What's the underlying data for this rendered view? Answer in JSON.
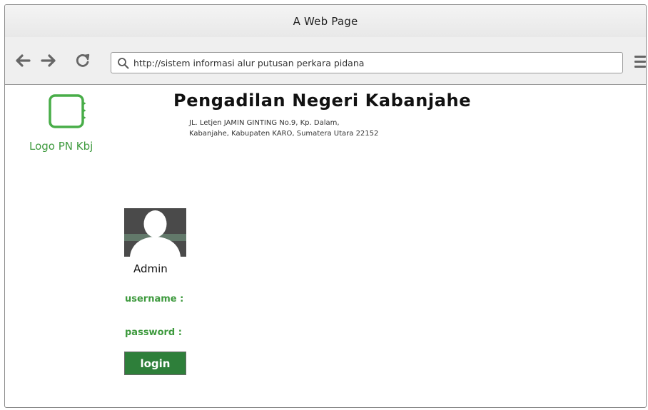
{
  "window": {
    "title": "A Web Page"
  },
  "toolbar": {
    "url": "http://sistem informasi alur putusan perkara pidana",
    "icons": [
      "back-arrow-icon",
      "forward-arrow-icon",
      "reload-icon",
      "search-icon",
      "hamburger-menu-icon"
    ]
  },
  "header": {
    "logo_label": "Logo PN Kbj",
    "title": "Pengadilan Negeri Kabanjahe",
    "address_line1": "JL. Letjen JAMIN GINTING No.9, Kp. Dalam,",
    "address_line2": "Kabanjahe, Kabupaten KARO, Sumatera Utara 22152"
  },
  "login": {
    "role_label": "Admin",
    "username_label": "username :",
    "password_label": "password :",
    "button_label": "login"
  },
  "colors": {
    "accent_green": "#3e9a3e",
    "button_green": "#2e7f3a",
    "icon_gray": "#666666"
  }
}
